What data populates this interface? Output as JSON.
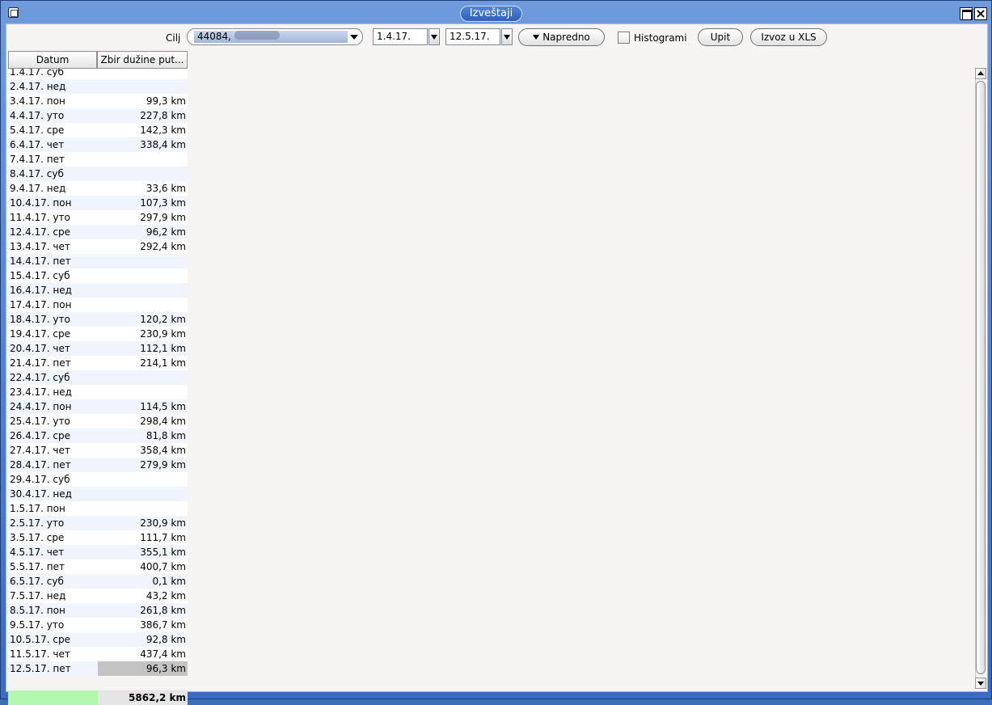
{
  "window": {
    "title": "Izveštaji"
  },
  "toolbar": {
    "target_label": "Cilj",
    "target_value": "44084,",
    "date_from": "1.4.17.",
    "date_to": "12.5.17.",
    "advanced_label": "Napredno",
    "histograms_label": "Histogrami",
    "histograms_checked": false,
    "query_label": "Upit",
    "export_label": "Izvoz u XLS"
  },
  "table": {
    "columns": [
      "Datum",
      "Zbir dužine put..."
    ],
    "rows": [
      {
        "date": "1.4.17. суб",
        "km": ""
      },
      {
        "date": "2.4.17. нед",
        "km": ""
      },
      {
        "date": "3.4.17. пон",
        "km": "99,3 km"
      },
      {
        "date": "4.4.17. уто",
        "km": "227,8 km"
      },
      {
        "date": "5.4.17. сре",
        "km": "142,3 km"
      },
      {
        "date": "6.4.17. чет",
        "km": "338,4 km"
      },
      {
        "date": "7.4.17. пет",
        "km": ""
      },
      {
        "date": "8.4.17. суб",
        "km": ""
      },
      {
        "date": "9.4.17. нед",
        "km": "33,6 km"
      },
      {
        "date": "10.4.17. пон",
        "km": "107,3 km"
      },
      {
        "date": "11.4.17. уто",
        "km": "297,9 km"
      },
      {
        "date": "12.4.17. сре",
        "km": "96,2 km"
      },
      {
        "date": "13.4.17. чет",
        "km": "292,4 km"
      },
      {
        "date": "14.4.17. пет",
        "km": ""
      },
      {
        "date": "15.4.17. суб",
        "km": ""
      },
      {
        "date": "16.4.17. нед",
        "km": ""
      },
      {
        "date": "17.4.17. пон",
        "km": ""
      },
      {
        "date": "18.4.17. уто",
        "km": "120,2 km"
      },
      {
        "date": "19.4.17. сре",
        "km": "230,9 km"
      },
      {
        "date": "20.4.17. чет",
        "km": "112,1 km"
      },
      {
        "date": "21.4.17. пет",
        "km": "214,1 km"
      },
      {
        "date": "22.4.17. суб",
        "km": ""
      },
      {
        "date": "23.4.17. нед",
        "km": ""
      },
      {
        "date": "24.4.17. пон",
        "km": "114,5 km"
      },
      {
        "date": "25.4.17. уто",
        "km": "298,4 km"
      },
      {
        "date": "26.4.17. сре",
        "km": "81,8 km"
      },
      {
        "date": "27.4.17. чет",
        "km": "358,4 km"
      },
      {
        "date": "28.4.17. пет",
        "km": "279,9 km"
      },
      {
        "date": "29.4.17. суб",
        "km": ""
      },
      {
        "date": "30.4.17. нед",
        "km": ""
      },
      {
        "date": "1.5.17. пон",
        "km": ""
      },
      {
        "date": "2.5.17. уто",
        "km": "230,9 km"
      },
      {
        "date": "3.5.17. сре",
        "km": "111,7 km"
      },
      {
        "date": "4.5.17. чет",
        "km": "355,1 km"
      },
      {
        "date": "5.5.17. пет",
        "km": "400,7 km"
      },
      {
        "date": "6.5.17. суб",
        "km": "0,1 km"
      },
      {
        "date": "7.5.17. нед",
        "km": "43,2 km"
      },
      {
        "date": "8.5.17. пон",
        "km": "261,8 km"
      },
      {
        "date": "9.5.17. уто",
        "km": "386,7 km"
      },
      {
        "date": "10.5.17. сре",
        "km": "92,8 km"
      },
      {
        "date": "11.5.17. чет",
        "km": "437,4 km"
      },
      {
        "date": "12.5.17. пет",
        "km": "96,3 km"
      }
    ],
    "total": "5862,2 km"
  },
  "colors": {
    "title_bar": "#3a6bc0",
    "total_highlight": "#b3f7b0",
    "selected_cell": "#c3c3c3"
  }
}
